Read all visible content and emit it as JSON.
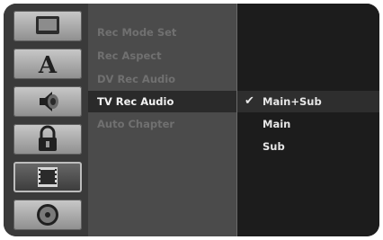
{
  "icons": [
    {
      "name": "display-icon",
      "selected": false
    },
    {
      "name": "language-icon",
      "label": "A",
      "selected": false
    },
    {
      "name": "audio-speaker-icon",
      "selected": false
    },
    {
      "name": "lock-icon",
      "selected": false
    },
    {
      "name": "film-record-icon",
      "selected": true
    },
    {
      "name": "disc-icon",
      "selected": false
    }
  ],
  "menu": {
    "items": [
      {
        "label": "Rec Mode Set",
        "active": false
      },
      {
        "label": "Rec Aspect",
        "active": false
      },
      {
        "label": "DV Rec Audio",
        "active": false
      },
      {
        "label": "TV Rec Audio",
        "active": true
      },
      {
        "label": "Auto Chapter",
        "active": false
      }
    ]
  },
  "options": {
    "check_mark": "✔",
    "items": [
      {
        "label": "Main+Sub",
        "selected": true
      },
      {
        "label": "Main",
        "selected": false
      },
      {
        "label": "Sub",
        "selected": false
      }
    ]
  },
  "colors": {
    "background": "#1e1e1e",
    "icon_strip": "#3a3a3a",
    "menu_panel": "#4b4b4b",
    "active_text": "#f2f2f2",
    "inactive_text": "#707070"
  }
}
